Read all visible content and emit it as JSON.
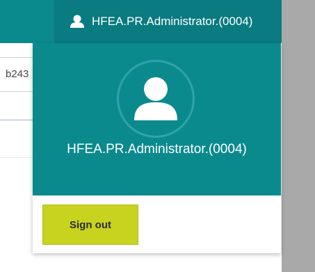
{
  "header": {
    "username": "HFEA.PR.Administrator.(0004)",
    "user_icon": "user-icon"
  },
  "background": {
    "field_text": "b243"
  },
  "user_menu": {
    "avatar_icon": "user-avatar-icon",
    "username": "HFEA.PR.Administrator.(0004)",
    "sign_out_label": "Sign out"
  },
  "colors": {
    "header_teal": "#0b8a8e",
    "header_user_teal": "#0a7b80",
    "signout_yellow": "#c7d31f",
    "scrim_gray": "#a9a9a9"
  }
}
